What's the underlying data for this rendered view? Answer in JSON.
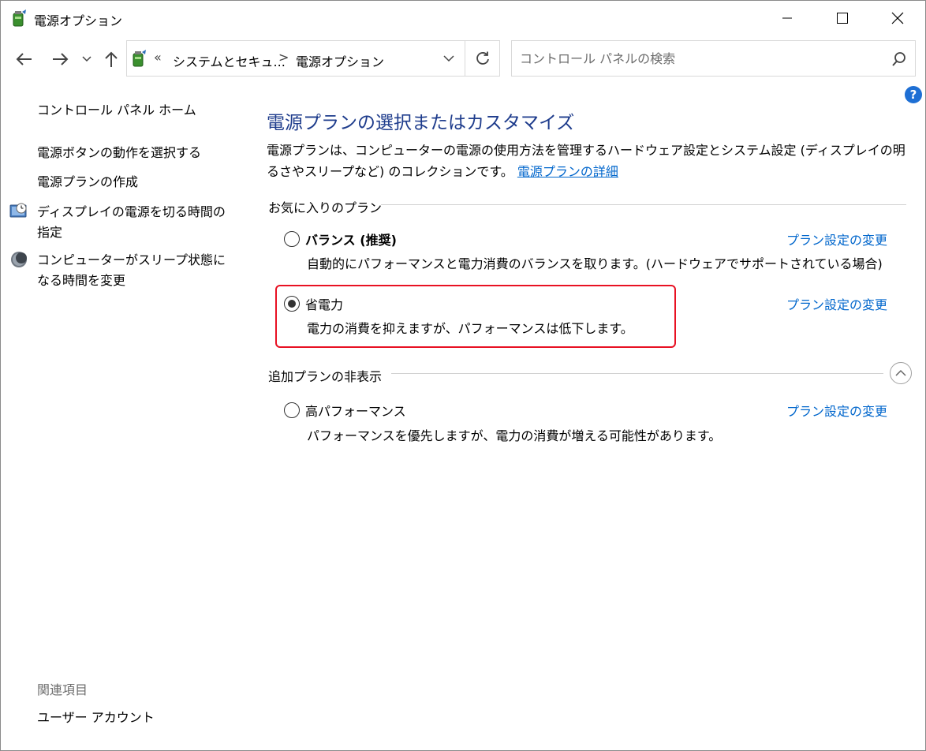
{
  "window": {
    "title": "電源オプション"
  },
  "address_bar": {
    "overflow": "«",
    "crumbs": [
      "システムとセキュ...",
      "電源オプション"
    ],
    "separator": ">"
  },
  "search": {
    "placeholder": "コントロール パネルの検索"
  },
  "help": {
    "label": "?"
  },
  "sidebar": {
    "home": "コントロール パネル ホーム",
    "items": [
      {
        "label": "電源ボタンの動作を選択する"
      },
      {
        "label": "電源プランの作成"
      },
      {
        "label": "ディスプレイの電源を切る時間の指定"
      },
      {
        "label": "コンピューターがスリープ状態になる時間を変更"
      }
    ],
    "related_heading": "関連項目",
    "related_items": [
      {
        "label": "ユーザー アカウント"
      }
    ]
  },
  "main": {
    "title": "電源プランの選択またはカスタマイズ",
    "description": "電源プランは、コンピューターの電源の使用方法を管理するハードウェア設定とシステム設定 (ディスプレイの明るさやスリープなど) のコレクションです。",
    "description_link": "電源プランの詳細",
    "favorites_label": "お気に入りのプラン",
    "hidden_label": "追加プランの非表示",
    "change_link": "プラン設定の変更",
    "plans": [
      {
        "name": "バランス (推奨)",
        "description": "自動的にパフォーマンスと電力消費のバランスを取ります。(ハードウェアでサポートされている場合)",
        "selected": false
      },
      {
        "name": "省電力",
        "description": "電力の消費を抑えますが、パフォーマンスは低下します。",
        "selected": true
      },
      {
        "name": "高パフォーマンス",
        "description": "パフォーマンスを優先しますが、電力の消費が増える可能性があります。",
        "selected": false
      }
    ]
  },
  "colors": {
    "heading": "#1e3c8c",
    "link": "#0066cc",
    "highlight_border": "#e81123",
    "help_badge": "#1e6fd4"
  },
  "icons": {
    "window": "power-options-icon",
    "back": "arrow-left-icon",
    "forward": "arrow-right-icon",
    "recent": "chevron-down-icon",
    "up": "arrow-up-icon",
    "refresh": "refresh-icon",
    "search": "search-icon",
    "display": "display-clock-icon",
    "sleep": "moon-icon"
  }
}
